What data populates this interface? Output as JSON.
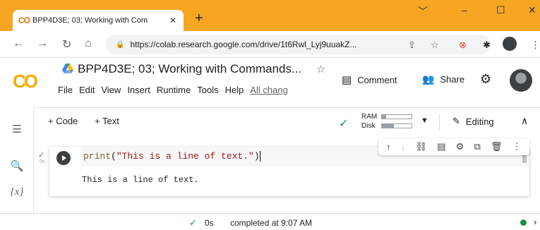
{
  "browser": {
    "tab": {
      "favicon": "CO",
      "title": "BPP4D3E; 03; Working with Com",
      "close_label": "✕"
    },
    "new_tab_label": "+",
    "window": {
      "minimize": "–",
      "maximize": "☐",
      "close": "✕",
      "chevron": "﹀"
    },
    "url": "https://colab.research.google.com/drive/1t6Rwl_Lyj9uuakZ...",
    "icons": [
      "back-icon",
      "forward-icon",
      "reload-icon",
      "home-icon",
      "lock-icon",
      "share-icon",
      "star-icon",
      "extension-icon",
      "puzzle-icon",
      "profile-icon",
      "kebab-icon"
    ]
  },
  "colab": {
    "logo": "CO",
    "notebook_title": "BPP4D3E; 03; Working with Commands...",
    "menu": [
      "File",
      "Edit",
      "View",
      "Insert",
      "Runtime",
      "Tools",
      "Help"
    ],
    "all_changes_link": "All chang",
    "comment_label": "Comment",
    "share_label": "Share"
  },
  "toolbar": {
    "add_code": "+ Code",
    "add_text": "+ Text",
    "ram_label": "RAM",
    "disk_label": "Disk",
    "ram_fraction": 0.15,
    "disk_fraction": 0.4,
    "editing_label": "Editing"
  },
  "cell": {
    "exec_time": "0s",
    "code": {
      "fn": "print",
      "open": "(",
      "string": "\"This is a line of text.\"",
      "close": ")"
    },
    "output": "This is a line of text."
  },
  "statusbar": {
    "time": "0s",
    "message": "completed at 9:07 AM"
  },
  "colors": {
    "tab_strip": "#f6a623",
    "success": "#1e8e3e",
    "colab_orange": "#f9ab00"
  }
}
